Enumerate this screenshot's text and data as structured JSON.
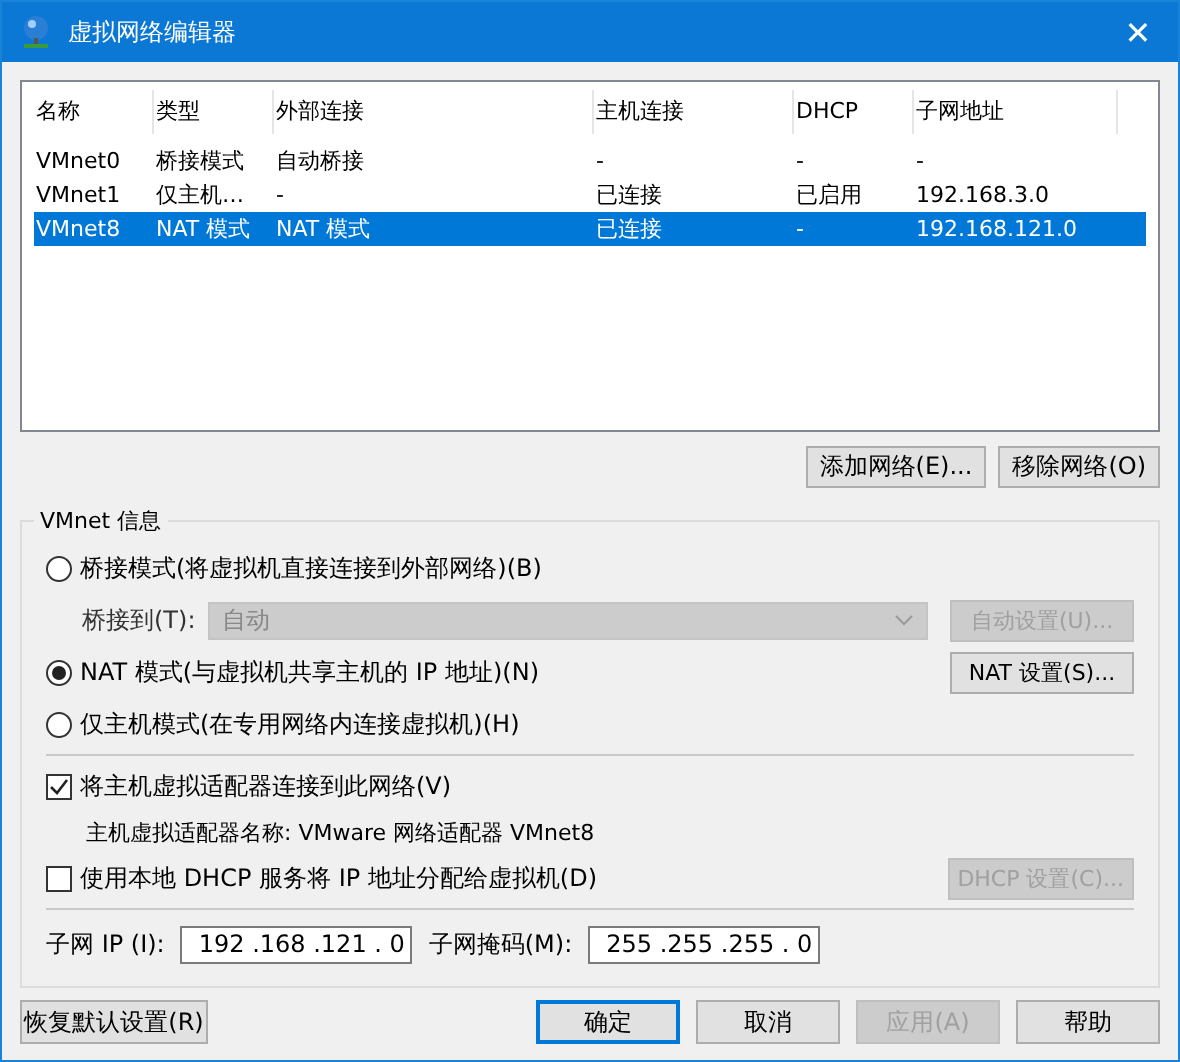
{
  "window": {
    "title": "虚拟网络编辑器",
    "close": "✕"
  },
  "network_table": {
    "columns": [
      "名称",
      "类型",
      "外部连接",
      "主机连接",
      "DHCP",
      "子网地址"
    ],
    "rows": [
      {
        "cells": [
          "VMnet0",
          "桥接模式",
          "自动桥接",
          "-",
          "-",
          "-"
        ],
        "selected": false
      },
      {
        "cells": [
          "VMnet1",
          "仅主机…",
          "-",
          "已连接",
          "已启用",
          "192.168.3.0"
        ],
        "selected": false
      },
      {
        "cells": [
          "VMnet8",
          "NAT 模式",
          "NAT 模式",
          "已连接",
          "-",
          "192.168.121.0"
        ],
        "selected": true
      }
    ]
  },
  "table_buttons": [
    {
      "label": "添加网络(E)..."
    },
    {
      "label": "移除网络(O)"
    }
  ],
  "vmnet_info": {
    "title": "VMnet 信息",
    "modes": [
      {
        "label": "桥接模式(将虚拟机直接连接到外部网络)(B)",
        "selected": false
      },
      {
        "label": "NAT 模式(与虚拟机共享主机的 IP 地址)(N)",
        "selected": true
      },
      {
        "label": "仅主机模式(在专用网络内连接虚拟机)(H)",
        "selected": false
      }
    ],
    "bridge_to": {
      "label": "桥接到(T):",
      "value": "自动",
      "disabled": true
    },
    "auto_settings": {
      "label": "自动设置(U)...",
      "disabled": true
    },
    "nat_settings": {
      "label": "NAT 设置(S)...",
      "disabled": false
    },
    "connect_adapter": {
      "label": "将主机虚拟适配器连接到此网络(V)",
      "checked": true
    },
    "adapter_name": "主机虚拟适配器名称: VMware 网络适配器 VMnet8",
    "use_dhcp": {
      "label": "使用本地 DHCP 服务将 IP 地址分配给虚拟机(D)",
      "checked": false
    },
    "dhcp_settings": {
      "label": "DHCP 设置(C)...",
      "disabled": true
    },
    "subnet_ip": {
      "label": "子网 IP (I):",
      "value": "192 .168 .121 . 0"
    },
    "subnet_mask": {
      "label": "子网掩码(M):",
      "value": "255 .255 .255 . 0"
    }
  },
  "footer_buttons": [
    {
      "label": "恢复默认设置(R)",
      "disabled": false,
      "default": false
    },
    {
      "label": "确定",
      "disabled": false,
      "default": true
    },
    {
      "label": "取消",
      "disabled": false,
      "default": false
    },
    {
      "label": "应用(A)",
      "disabled": true,
      "default": false
    },
    {
      "label": "帮助",
      "disabled": false,
      "default": false
    }
  ]
}
